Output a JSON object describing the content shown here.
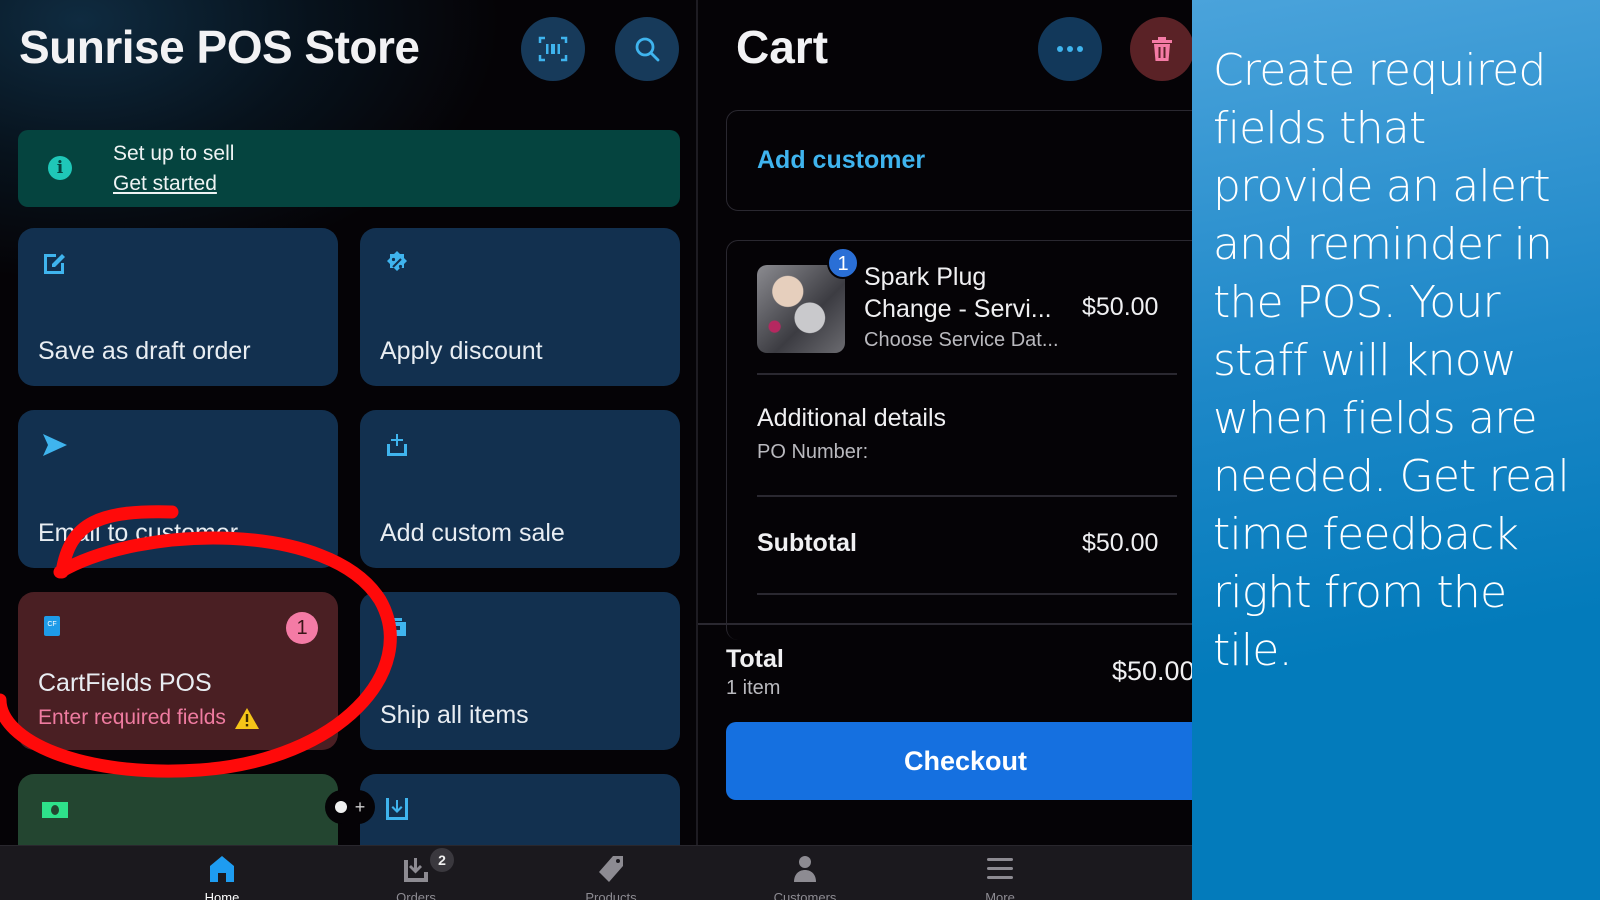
{
  "home": {
    "title": "Sunrise POS Store",
    "scan_button_icon": "barcode-scan-icon",
    "search_button_icon": "search-icon",
    "banner": {
      "icon": "info-icon",
      "title": "Set up to sell",
      "link": "Get started"
    },
    "tiles": [
      {
        "label": "Save as draft order",
        "icon": "edit-draft-icon"
      },
      {
        "label": "Apply discount",
        "icon": "discount-badge-icon"
      },
      {
        "label": "Email to customer",
        "icon": "send-icon"
      },
      {
        "label": "Add custom sale",
        "icon": "add-to-tray-icon"
      },
      {
        "label": "CartFields POS",
        "sublabel": "Enter required fields",
        "badge": "1",
        "icon": "cartfields-app-icon",
        "warning_icon": "warning-icon"
      },
      {
        "label": "Ship all items",
        "icon": "shipping-box-icon"
      },
      {
        "label": "",
        "icon": "cash-icon"
      },
      {
        "label": "",
        "icon": "download-tray-icon"
      }
    ],
    "page_indicator_plus": "+"
  },
  "cart": {
    "title": "Cart",
    "more_icon": "more-horizontal-icon",
    "trash_icon": "trash-icon",
    "add_customer": "Add customer",
    "line_item": {
      "quantity": "1",
      "name": "Spark Plug Change - Servi...",
      "price": "$50.00",
      "property": "Choose Service Dat..."
    },
    "additional_details": {
      "title": "Additional details",
      "field": "PO Number:"
    },
    "subtotal_label": "Subtotal",
    "subtotal_value": "$50.00",
    "total_label": "Total",
    "total_items": "1 item",
    "total_value": "$50.00",
    "checkout_label": "Checkout"
  },
  "bottom_nav": [
    {
      "label": "Home",
      "icon": "home-icon",
      "active": true
    },
    {
      "label": "Orders",
      "icon": "orders-icon",
      "badge": "2"
    },
    {
      "label": "Products",
      "icon": "tag-icon"
    },
    {
      "label": "Customers",
      "icon": "person-icon"
    },
    {
      "label": "More",
      "icon": "menu-icon"
    }
  ],
  "caption": {
    "text": "Create required fields that provide an alert and reminder in the POS. Your staff will know when fields are needed. Get real time feedback right from the tile."
  },
  "colors": {
    "accent_blue": "#3fb4ee",
    "checkout_blue": "#1570e0",
    "alert_pink": "#ef7ba0",
    "tile_blue": "#12304f",
    "tile_alert": "#4a1f23",
    "annotation_red": "#ff0a0a",
    "caption_bg": "#037bbb"
  }
}
